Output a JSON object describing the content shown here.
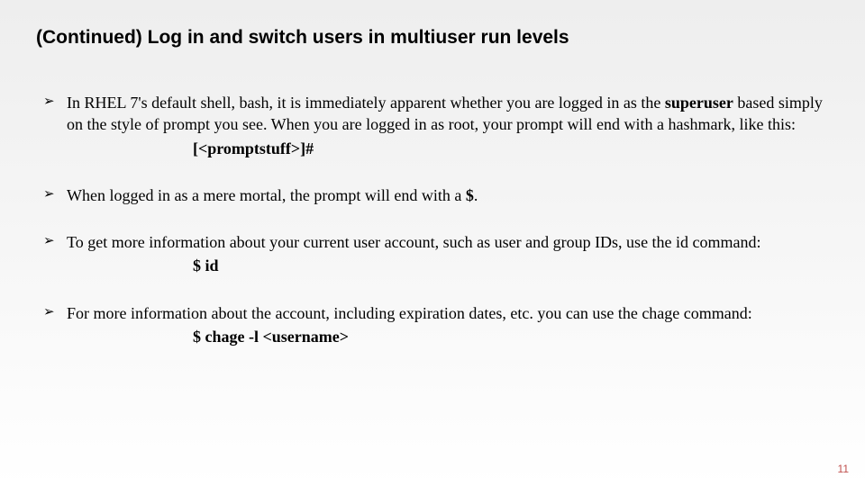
{
  "title": "(Continued) Log in and switch users in multiuser run levels",
  "bullets": [
    {
      "pre": "In RHEL 7's default shell, bash, it is immediately apparent whether you are logged in as the ",
      "bold1": "superuser",
      "post": " based simply on the style of prompt you see. When you are logged in as root, your prompt will end with a hashmark, like this:",
      "indent": "[<promptstuff>]#"
    },
    {
      "pre": "When logged in as a mere mortal, the prompt will end with a ",
      "bold1": "$",
      "post": ".",
      "indent": ""
    },
    {
      "pre": "To get more information about your current user account, such as user and group IDs, use the id command:",
      "bold1": "",
      "post": "",
      "indent": "$ id"
    },
    {
      "pre": "For more information about the account, including expiration dates, etc. you can use the chage command:",
      "bold1": "",
      "post": "",
      "indent": "$ chage -l <username>"
    }
  ],
  "page_number": "11"
}
